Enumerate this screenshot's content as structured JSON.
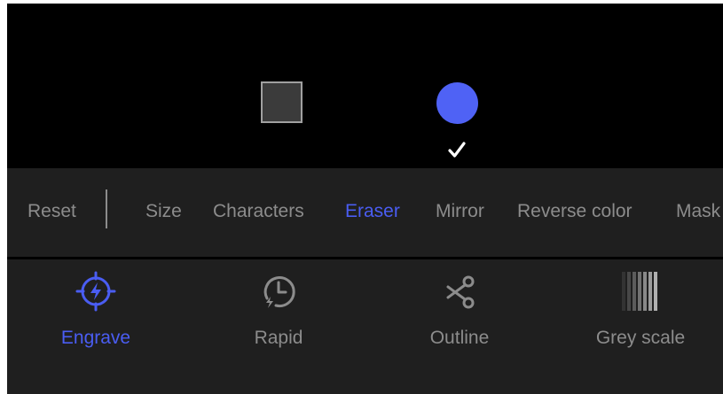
{
  "eraser_shapes": {
    "options": [
      "square",
      "circle"
    ],
    "selected": "circle",
    "square_color": "#3b3b3b",
    "circle_color": "#4f62f5"
  },
  "edit_toolbar": {
    "items": [
      {
        "label": "Reset",
        "active": false
      },
      {
        "label": "Size",
        "active": false
      },
      {
        "label": "Characters",
        "active": false
      },
      {
        "label": "Eraser",
        "active": true
      },
      {
        "label": "Mirror",
        "active": false
      },
      {
        "label": "Reverse color",
        "active": false
      },
      {
        "label": "Mask",
        "active": false
      }
    ]
  },
  "mode_bar": {
    "items": [
      {
        "label": "Engrave",
        "icon": "engrave-icon",
        "active": true
      },
      {
        "label": "Rapid",
        "icon": "rapid-icon",
        "active": false
      },
      {
        "label": "Outline",
        "icon": "scissors-icon",
        "active": false
      },
      {
        "label": "Grey scale",
        "icon": "grey-scale-icon",
        "active": false
      }
    ]
  },
  "colors": {
    "accent": "#4a5df2",
    "inactive_text": "#8c8c8c",
    "panel_background": "#1f1f1f",
    "canvas_background": "#000000"
  }
}
